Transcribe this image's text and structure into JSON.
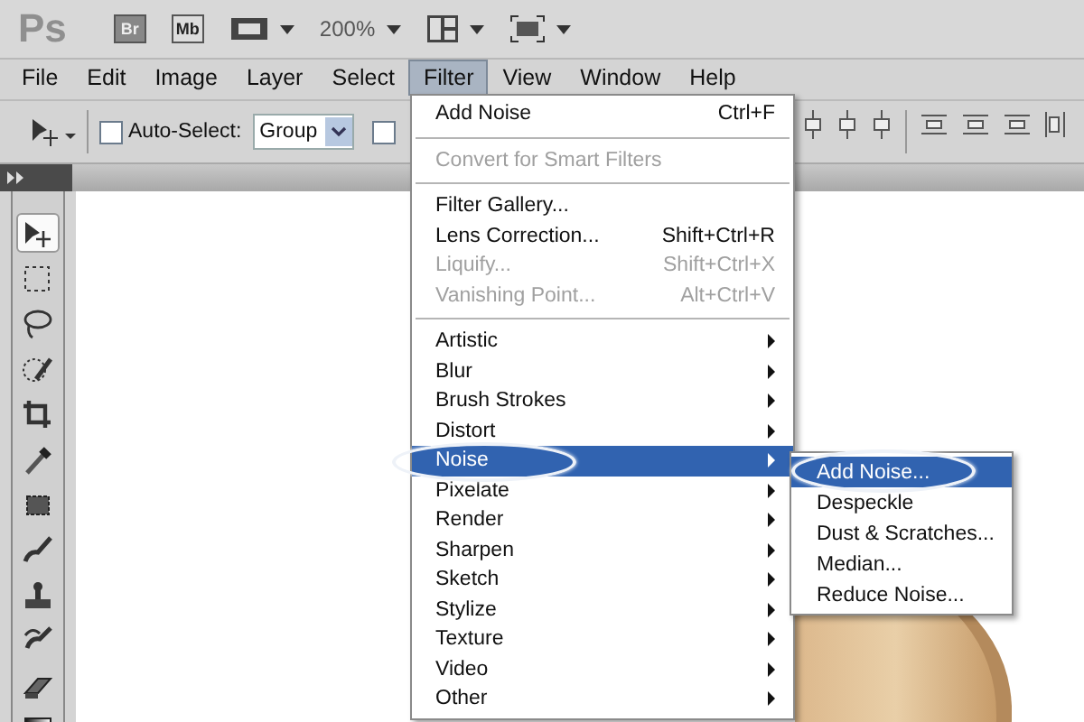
{
  "app_bar": {
    "logo": "Ps",
    "buttons": [
      {
        "label": "Br"
      },
      {
        "label": "Mb"
      }
    ],
    "zoom": "200%"
  },
  "menu_bar": [
    {
      "label": "File",
      "selected": false
    },
    {
      "label": "Edit",
      "selected": false
    },
    {
      "label": "Image",
      "selected": false
    },
    {
      "label": "Layer",
      "selected": false
    },
    {
      "label": "Select",
      "selected": false
    },
    {
      "label": "Filter",
      "selected": true
    },
    {
      "label": "View",
      "selected": false
    },
    {
      "label": "Window",
      "selected": false
    },
    {
      "label": "Help",
      "selected": false
    }
  ],
  "options_bar": {
    "auto_select": {
      "label": "Auto-Select:",
      "checked": false
    },
    "auto_select_target": "Group",
    "second_checkbox": {
      "checked": false
    }
  },
  "toolbox": [
    {
      "kind": "move",
      "selected": true
    },
    {
      "kind": "marquee",
      "selected": false
    },
    {
      "kind": "lasso",
      "selected": false
    },
    {
      "kind": "quick",
      "selected": false
    },
    {
      "kind": "crop",
      "selected": false
    },
    {
      "kind": "eyedropper",
      "selected": false
    },
    {
      "kind": "patch",
      "selected": false
    },
    {
      "kind": "brush",
      "selected": false
    },
    {
      "kind": "stamp",
      "selected": false
    },
    {
      "kind": "history",
      "selected": false
    },
    {
      "kind": "eraser",
      "selected": false
    },
    {
      "kind": "gradient",
      "selected": false
    }
  ],
  "filter_menu": [
    {
      "kind": "item",
      "label": "Add Noise",
      "shortcut": "Ctrl+F",
      "disabled": false,
      "selected": false
    },
    {
      "kind": "separator"
    },
    {
      "kind": "item",
      "label": "Convert for Smart Filters",
      "disabled": true,
      "selected": false
    },
    {
      "kind": "separator"
    },
    {
      "kind": "item",
      "label": "Filter Gallery...",
      "disabled": false,
      "selected": false
    },
    {
      "kind": "item",
      "label": "Lens Correction...",
      "shortcut": "Shift+Ctrl+R",
      "disabled": false,
      "selected": false
    },
    {
      "kind": "item",
      "label": "Liquify...",
      "shortcut": "Shift+Ctrl+X",
      "disabled": true,
      "selected": false
    },
    {
      "kind": "item",
      "label": "Vanishing Point...",
      "shortcut": "Alt+Ctrl+V",
      "disabled": true,
      "selected": false
    },
    {
      "kind": "separator"
    },
    {
      "kind": "submenu",
      "label": "Artistic",
      "disabled": false,
      "selected": false
    },
    {
      "kind": "submenu",
      "label": "Blur",
      "disabled": false,
      "selected": false
    },
    {
      "kind": "submenu",
      "label": "Brush Strokes",
      "disabled": false,
      "selected": false
    },
    {
      "kind": "submenu",
      "label": "Distort",
      "disabled": false,
      "selected": false
    },
    {
      "kind": "submenu",
      "label": "Noise",
      "disabled": false,
      "selected": true
    },
    {
      "kind": "submenu",
      "label": "Pixelate",
      "disabled": false,
      "selected": false
    },
    {
      "kind": "submenu",
      "label": "Render",
      "disabled": false,
      "selected": false
    },
    {
      "kind": "submenu",
      "label": "Sharpen",
      "disabled": false,
      "selected": false
    },
    {
      "kind": "submenu",
      "label": "Sketch",
      "disabled": false,
      "selected": false
    },
    {
      "kind": "submenu",
      "label": "Stylize",
      "disabled": false,
      "selected": false
    },
    {
      "kind": "submenu",
      "label": "Texture",
      "disabled": false,
      "selected": false
    },
    {
      "kind": "submenu",
      "label": "Video",
      "disabled": false,
      "selected": false
    },
    {
      "kind": "submenu",
      "label": "Other",
      "disabled": false,
      "selected": false
    }
  ],
  "noise_submenu": [
    {
      "label": "Add Noise...",
      "selected": true
    },
    {
      "label": "Despeckle",
      "selected": false
    },
    {
      "label": "Dust & Scratches...",
      "selected": false
    },
    {
      "label": "Median...",
      "selected": false
    },
    {
      "label": "Reduce Noise...",
      "selected": false
    }
  ]
}
